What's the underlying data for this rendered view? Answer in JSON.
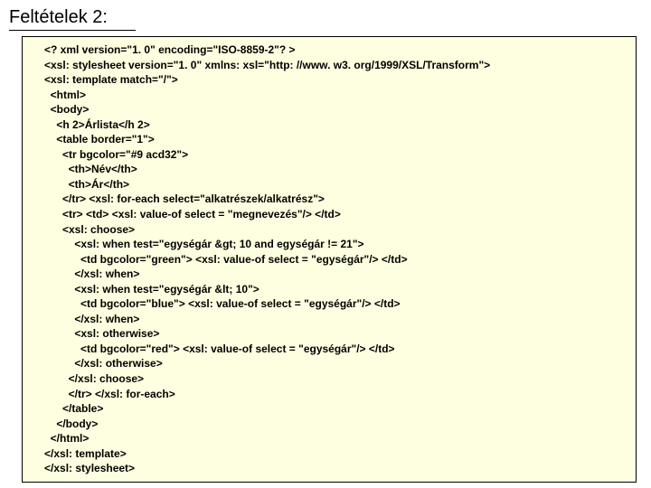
{
  "title": "Feltételek 2:",
  "code_lines": [
    {
      "indent": 0,
      "text": "<? xml version=\"1. 0\" encoding=\"ISO-8859-2\"? >"
    },
    {
      "indent": 0,
      "text": "<xsl: stylesheet version=\"1. 0\" xmlns: xsl=\"http: //www. w3. org/1999/XSL/Transform\">"
    },
    {
      "indent": 0,
      "text": "<xsl: template match=\"/\">"
    },
    {
      "indent": 1,
      "text": "<html>"
    },
    {
      "indent": 1,
      "text": "<body>"
    },
    {
      "indent": 2,
      "text": "<h 2>Árlista</h 2>"
    },
    {
      "indent": 2,
      "text": "<table border=\"1\">"
    },
    {
      "indent": 3,
      "text": "<tr bgcolor=\"#9 acd32\">"
    },
    {
      "indent": 4,
      "text": "<th>Név</th>"
    },
    {
      "indent": 4,
      "text": "<th>Ár</th>"
    },
    {
      "indent": 3,
      "text": "</tr> <xsl: for-each select=\"alkatrészek/alkatrész\">"
    },
    {
      "indent": 3,
      "text": "<tr> <td> <xsl: value-of select = \"megnevezés\"/> </td>"
    },
    {
      "indent": 3,
      "text": "<xsl: choose>"
    },
    {
      "indent": 5,
      "text": "<xsl: when test=\"egységár &gt; 10 and egységár != 21\">"
    },
    {
      "indent": 6,
      "text": "<td bgcolor=\"green\"> <xsl: value-of select = \"egységár\"/> </td>"
    },
    {
      "indent": 5,
      "text": "</xsl: when>"
    },
    {
      "indent": 5,
      "text": "<xsl: when test=\"egységár &lt; 10\">"
    },
    {
      "indent": 6,
      "text": "<td bgcolor=\"blue\"> <xsl: value-of select = \"egységár\"/> </td>"
    },
    {
      "indent": 5,
      "text": "</xsl: when>"
    },
    {
      "indent": 5,
      "text": "<xsl: otherwise>"
    },
    {
      "indent": 6,
      "text": "<td bgcolor=\"red\"> <xsl: value-of select = \"egységár\"/> </td>"
    },
    {
      "indent": 5,
      "text": "</xsl: otherwise>"
    },
    {
      "indent": 4,
      "text": "</xsl: choose>"
    },
    {
      "indent": 4,
      "text": "</tr> </xsl: for-each>"
    },
    {
      "indent": 3,
      "text": "</table>"
    },
    {
      "indent": 2,
      "text": "</body>"
    },
    {
      "indent": 1,
      "text": "</html>"
    },
    {
      "indent": 0,
      "text": "</xsl: template>"
    },
    {
      "indent": 0,
      "text": "</xsl: stylesheet>"
    }
  ]
}
